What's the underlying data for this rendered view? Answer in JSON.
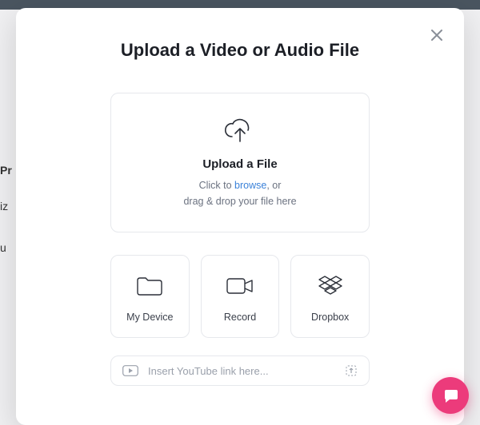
{
  "modal": {
    "title": "Upload a Video or Audio File",
    "dropzone": {
      "heading": "Upload a File",
      "hint_pre": "Click to ",
      "hint_link": "browse",
      "hint_post": ", or",
      "hint_line2": "drag & drop your file here"
    },
    "sources": [
      {
        "label": "My Device"
      },
      {
        "label": "Record"
      },
      {
        "label": "Dropbox"
      }
    ],
    "link_input": {
      "placeholder": "Insert YouTube link here..."
    }
  },
  "background": {
    "t1": "Pr",
    "t2": "iz",
    "t3": "u",
    "t4": "",
    "t5": ""
  }
}
